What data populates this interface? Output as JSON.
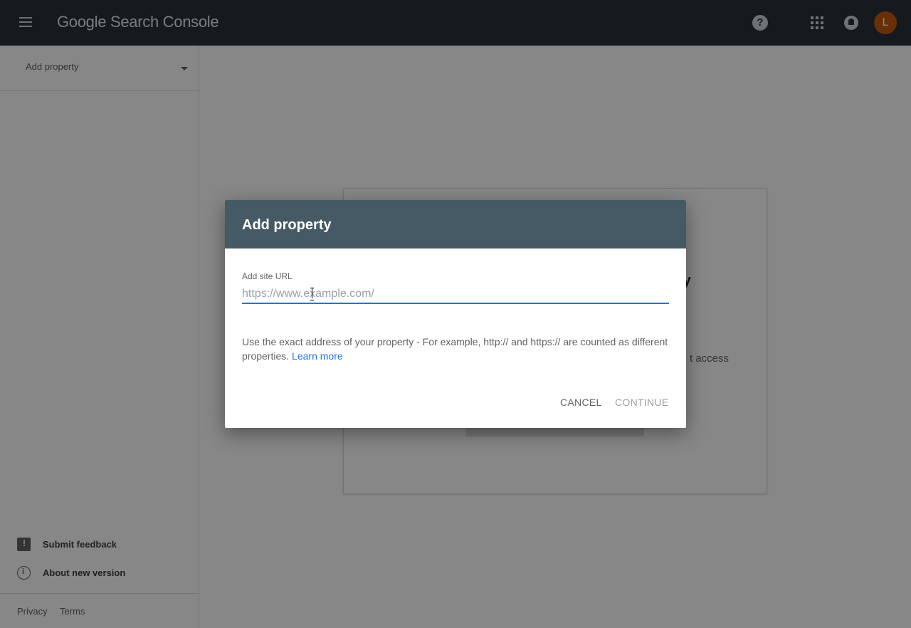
{
  "header": {
    "brand_google": "Google",
    "brand_product": "Search Console",
    "help_icon": "?",
    "avatar_initial": "L"
  },
  "sidebar": {
    "property_selector": "Add property",
    "items": [
      {
        "label": "Submit feedback",
        "icon": "feedback-icon"
      },
      {
        "label": "About new version",
        "icon": "info-icon"
      }
    ],
    "footer": {
      "privacy": "Privacy",
      "terms": "Terms"
    }
  },
  "background_card": {
    "fragment_title": "ty",
    "fragment_text": "t access"
  },
  "dialog": {
    "title": "Add property",
    "field_label": "Add site URL",
    "url_value": "",
    "url_placeholder": "https://www.example.com/",
    "hint_text": "Use the exact address of your property - For example, http:// and https:// are counted as different properties.",
    "learn_more": "Learn more",
    "cancel_label": "CANCEL",
    "continue_label": "CONTINUE"
  },
  "colors": {
    "topbar": "#263238",
    "dialog_header": "#455a64",
    "accent": "#1a73e8",
    "avatar": "#c55a11"
  }
}
